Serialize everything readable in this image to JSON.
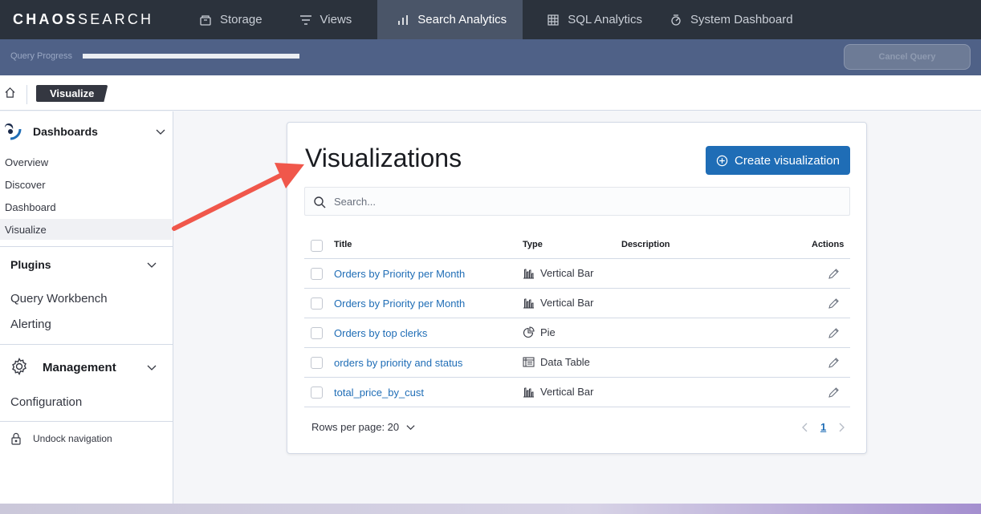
{
  "brand": {
    "bold": "CHAOS",
    "light": "SEARCH"
  },
  "topnav": {
    "tabs": [
      {
        "label": "Storage",
        "icon": "storage-icon"
      },
      {
        "label": "Views",
        "icon": "views-icon"
      },
      {
        "label": "Search Analytics",
        "icon": "bar-chart-icon",
        "active": true
      },
      {
        "label": "SQL Analytics",
        "icon": "grid-icon"
      },
      {
        "label": "System Dashboard",
        "icon": "dashboard-icon"
      }
    ]
  },
  "query": {
    "label": "Query Progress",
    "progress": 1.0,
    "cancel_label": "Cancel Query"
  },
  "breadcrumb": {
    "current": "Visualize"
  },
  "sidebar": {
    "dashboards": {
      "title": "Dashboards",
      "items": [
        "Overview",
        "Discover",
        "Dashboard",
        "Visualize"
      ],
      "active": "Visualize"
    },
    "plugins": {
      "title": "Plugins",
      "items": [
        "Query Workbench",
        "Alerting"
      ]
    },
    "management": {
      "title": "Management",
      "items": [
        "Configuration"
      ]
    },
    "undock": "Undock navigation"
  },
  "panel": {
    "title": "Visualizations",
    "create_label": "Create visualization",
    "search_placeholder": "Search...",
    "columns": {
      "title": "Title",
      "type": "Type",
      "description": "Description",
      "actions": "Actions"
    },
    "rows": [
      {
        "title": "Orders by Priority per Month",
        "type": "Vertical Bar",
        "type_icon": "vertical-bar-icon"
      },
      {
        "title": "Orders by Priority per Month",
        "type": "Vertical Bar",
        "type_icon": "vertical-bar-icon"
      },
      {
        "title": "Orders by top clerks",
        "type": "Pie",
        "type_icon": "pie-icon"
      },
      {
        "title": "orders by priority and status",
        "type": "Data Table",
        "type_icon": "data-table-icon"
      },
      {
        "title": "total_price_by_cust",
        "type": "Vertical Bar",
        "type_icon": "vertical-bar-icon"
      }
    ],
    "rows_per_page": "Rows per page: 20",
    "current_page": "1"
  },
  "colors": {
    "accent": "#1f6db6",
    "topnav_bg": "#2b323c",
    "progress_bg": "#4f6187",
    "arrow": "#f0574b"
  }
}
